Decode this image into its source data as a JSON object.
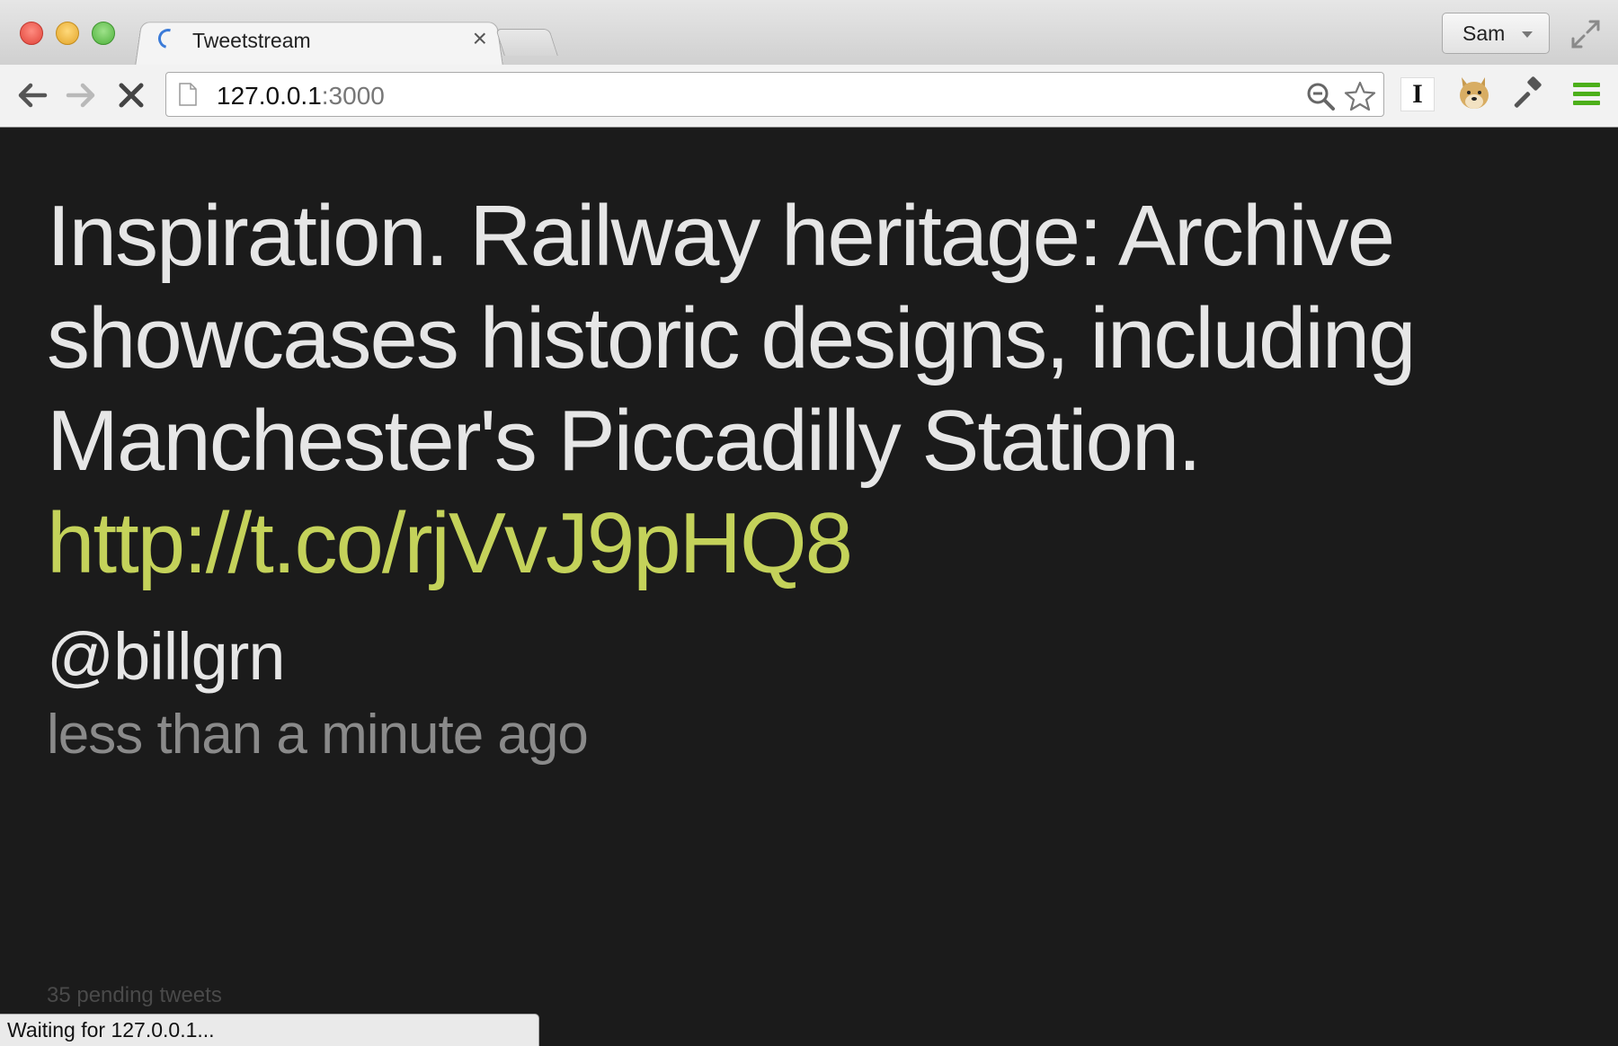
{
  "tab": {
    "title": "Tweetstream",
    "close_glyph": "×"
  },
  "profile": {
    "name": "Sam"
  },
  "omnibox": {
    "host": "127.0.0.1",
    "port": ":3000"
  },
  "extensions": {
    "instapaper_glyph": "I"
  },
  "tweet": {
    "text": "Inspiration. Railway heritage: Archive showcases historic designs, including Manchester's Piccadilly Station. ",
    "link": "http://t.co/rjVvJ9pHQ8",
    "author": "@billgrn",
    "time": "less than a minute ago"
  },
  "pending": {
    "label": "35 pending tweets"
  },
  "status_bar": {
    "text": "Waiting for 127.0.0.1..."
  },
  "colors": {
    "page_background": "#1b1b1b",
    "tweet_text": "#e6e6e6",
    "link": "#c4d25a",
    "timestamp": "#8a8a8a",
    "pending": "#4a4a4a"
  }
}
